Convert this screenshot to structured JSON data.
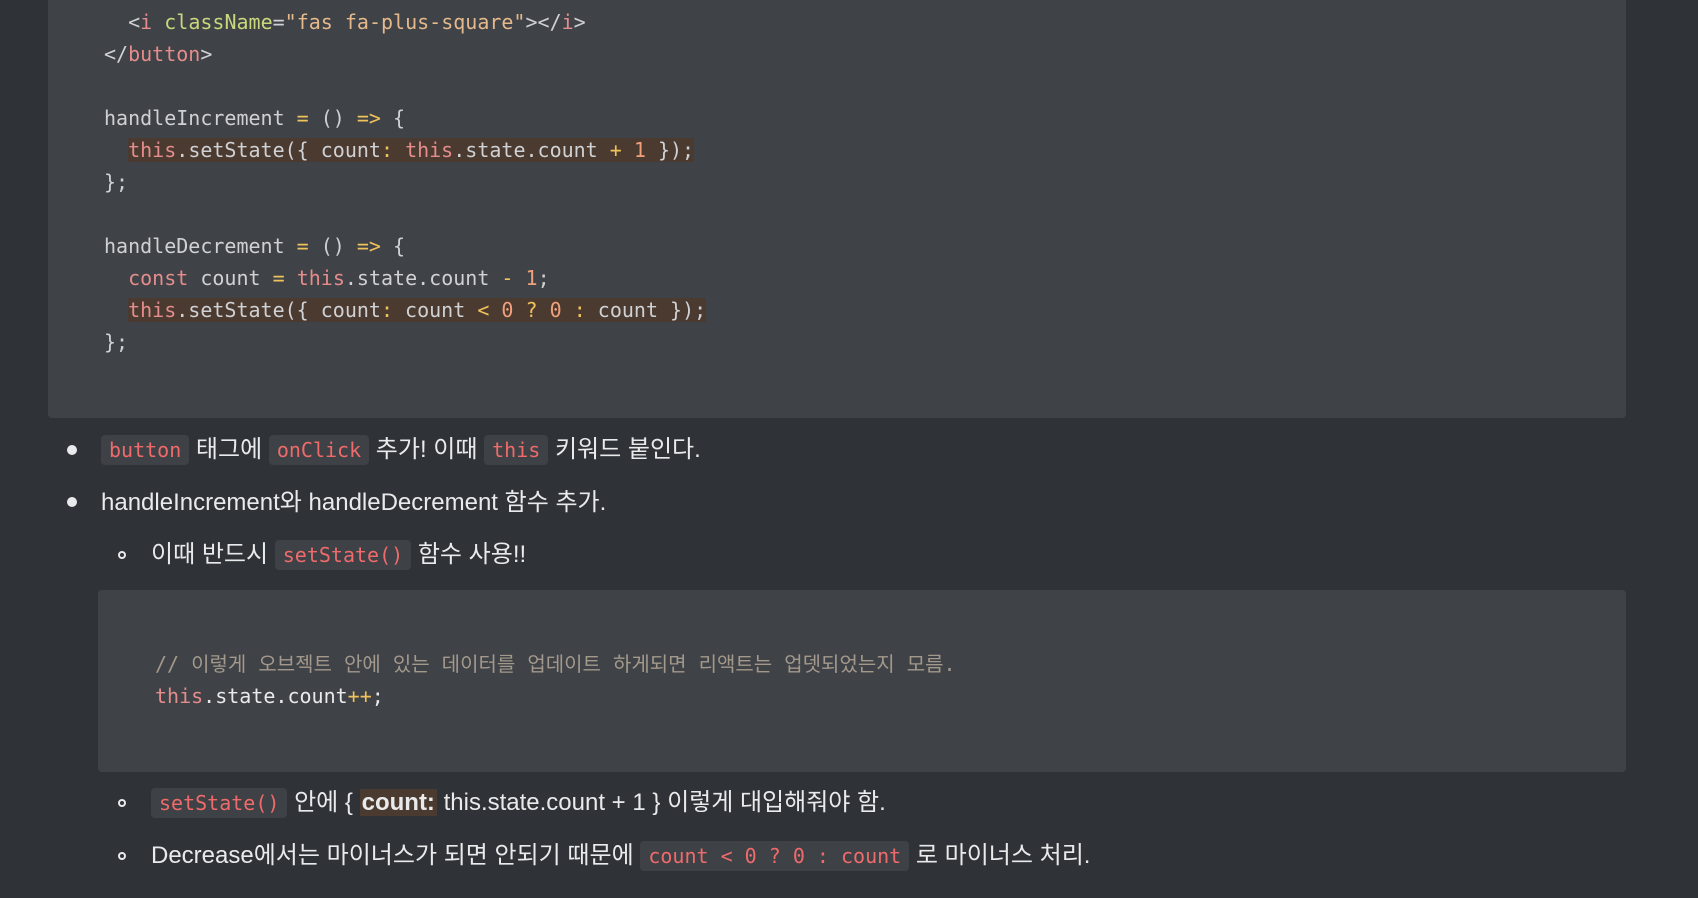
{
  "code1": {
    "lines": [
      {
        "indent": "  ",
        "parts": [
          [
            "punc",
            "<"
          ],
          [
            "tag",
            "i"
          ],
          [
            "punc",
            " "
          ],
          [
            "attr",
            "className"
          ],
          [
            "punc",
            "="
          ],
          [
            "str",
            "\"fas fa-plus-square\""
          ],
          [
            "punc",
            "></"
          ],
          [
            "tag",
            "i"
          ],
          [
            "punc",
            ">"
          ]
        ]
      },
      {
        "indent": "",
        "parts": [
          [
            "punc",
            "</"
          ],
          [
            "tag",
            "button"
          ],
          [
            "punc",
            ">"
          ]
        ]
      },
      {
        "indent": "",
        "parts": []
      },
      {
        "indent": "",
        "parts": [
          [
            "punc",
            "handleIncrement "
          ],
          [
            "op",
            "="
          ],
          [
            "punc",
            " () "
          ],
          [
            "op",
            "=>"
          ],
          [
            "punc",
            " {"
          ]
        ]
      },
      {
        "indent": "  ",
        "hl": true,
        "parts": [
          [
            "kw",
            "this"
          ],
          [
            "punc",
            "."
          ],
          [
            "punc",
            "setState({ count"
          ],
          [
            "op",
            ":"
          ],
          [
            "punc",
            " "
          ],
          [
            "kw",
            "this"
          ],
          [
            "punc",
            ".state.count "
          ],
          [
            "op",
            "+"
          ],
          [
            "punc",
            " "
          ],
          [
            "num",
            "1"
          ],
          [
            "punc",
            " });"
          ]
        ]
      },
      {
        "indent": "",
        "parts": [
          [
            "punc",
            "};"
          ]
        ]
      },
      {
        "indent": "",
        "parts": []
      },
      {
        "indent": "",
        "parts": [
          [
            "punc",
            "handleDecrement "
          ],
          [
            "op",
            "="
          ],
          [
            "punc",
            " () "
          ],
          [
            "op",
            "=>"
          ],
          [
            "punc",
            " {"
          ]
        ]
      },
      {
        "indent": "  ",
        "parts": [
          [
            "kw",
            "const"
          ],
          [
            "punc",
            " count "
          ],
          [
            "op",
            "="
          ],
          [
            "punc",
            " "
          ],
          [
            "kw",
            "this"
          ],
          [
            "punc",
            ".state.count "
          ],
          [
            "op",
            "-"
          ],
          [
            "punc",
            " "
          ],
          [
            "num",
            "1"
          ],
          [
            "punc",
            ";"
          ]
        ]
      },
      {
        "indent": "  ",
        "hl": true,
        "parts": [
          [
            "kw",
            "this"
          ],
          [
            "punc",
            ".setState({ count"
          ],
          [
            "op",
            ":"
          ],
          [
            "punc",
            " count "
          ],
          [
            "op",
            "<"
          ],
          [
            "punc",
            " "
          ],
          [
            "num",
            "0"
          ],
          [
            "punc",
            " "
          ],
          [
            "op",
            "?"
          ],
          [
            "punc",
            " "
          ],
          [
            "num",
            "0"
          ],
          [
            "punc",
            " "
          ],
          [
            "op",
            ":"
          ],
          [
            "punc",
            " count });"
          ]
        ]
      },
      {
        "indent": "",
        "parts": [
          [
            "punc",
            "};"
          ]
        ]
      }
    ]
  },
  "bullets": {
    "b1": {
      "code1": "button",
      "t1": " 태그에 ",
      "code2": "onClick",
      "t2": " 추가! 이때 ",
      "code3": "this",
      "t3": " 키워드 붙인다."
    },
    "b2": {
      "text": "handleIncrement와 handleDecrement 함수 추가."
    },
    "s1": {
      "t1": "이때 반드시 ",
      "code": "setState()",
      "t2": " 함수 사용!!"
    }
  },
  "code2": {
    "comment": "// 이렇게 오브젝트 안에 있는 데이터를 업데이트 하게되면 리액트는 업뎃되었는지 모름.",
    "line2_kw": "this",
    "line2_rest": ".state.count",
    "line2_op": "++",
    "line2_end": ";"
  },
  "sub": {
    "s2": {
      "code": "setState()",
      "t1": " 안에 { ",
      "strong": "count:",
      "t2": " this.state.count + 1 } 이렇게 대입해줘야 함."
    },
    "s3": {
      "t1": "Decrease에서는 마이너스가 되면 안되기 때문에 ",
      "code": "count < 0 ? 0 : count",
      "t2": " 로 마이너스 처리."
    }
  }
}
